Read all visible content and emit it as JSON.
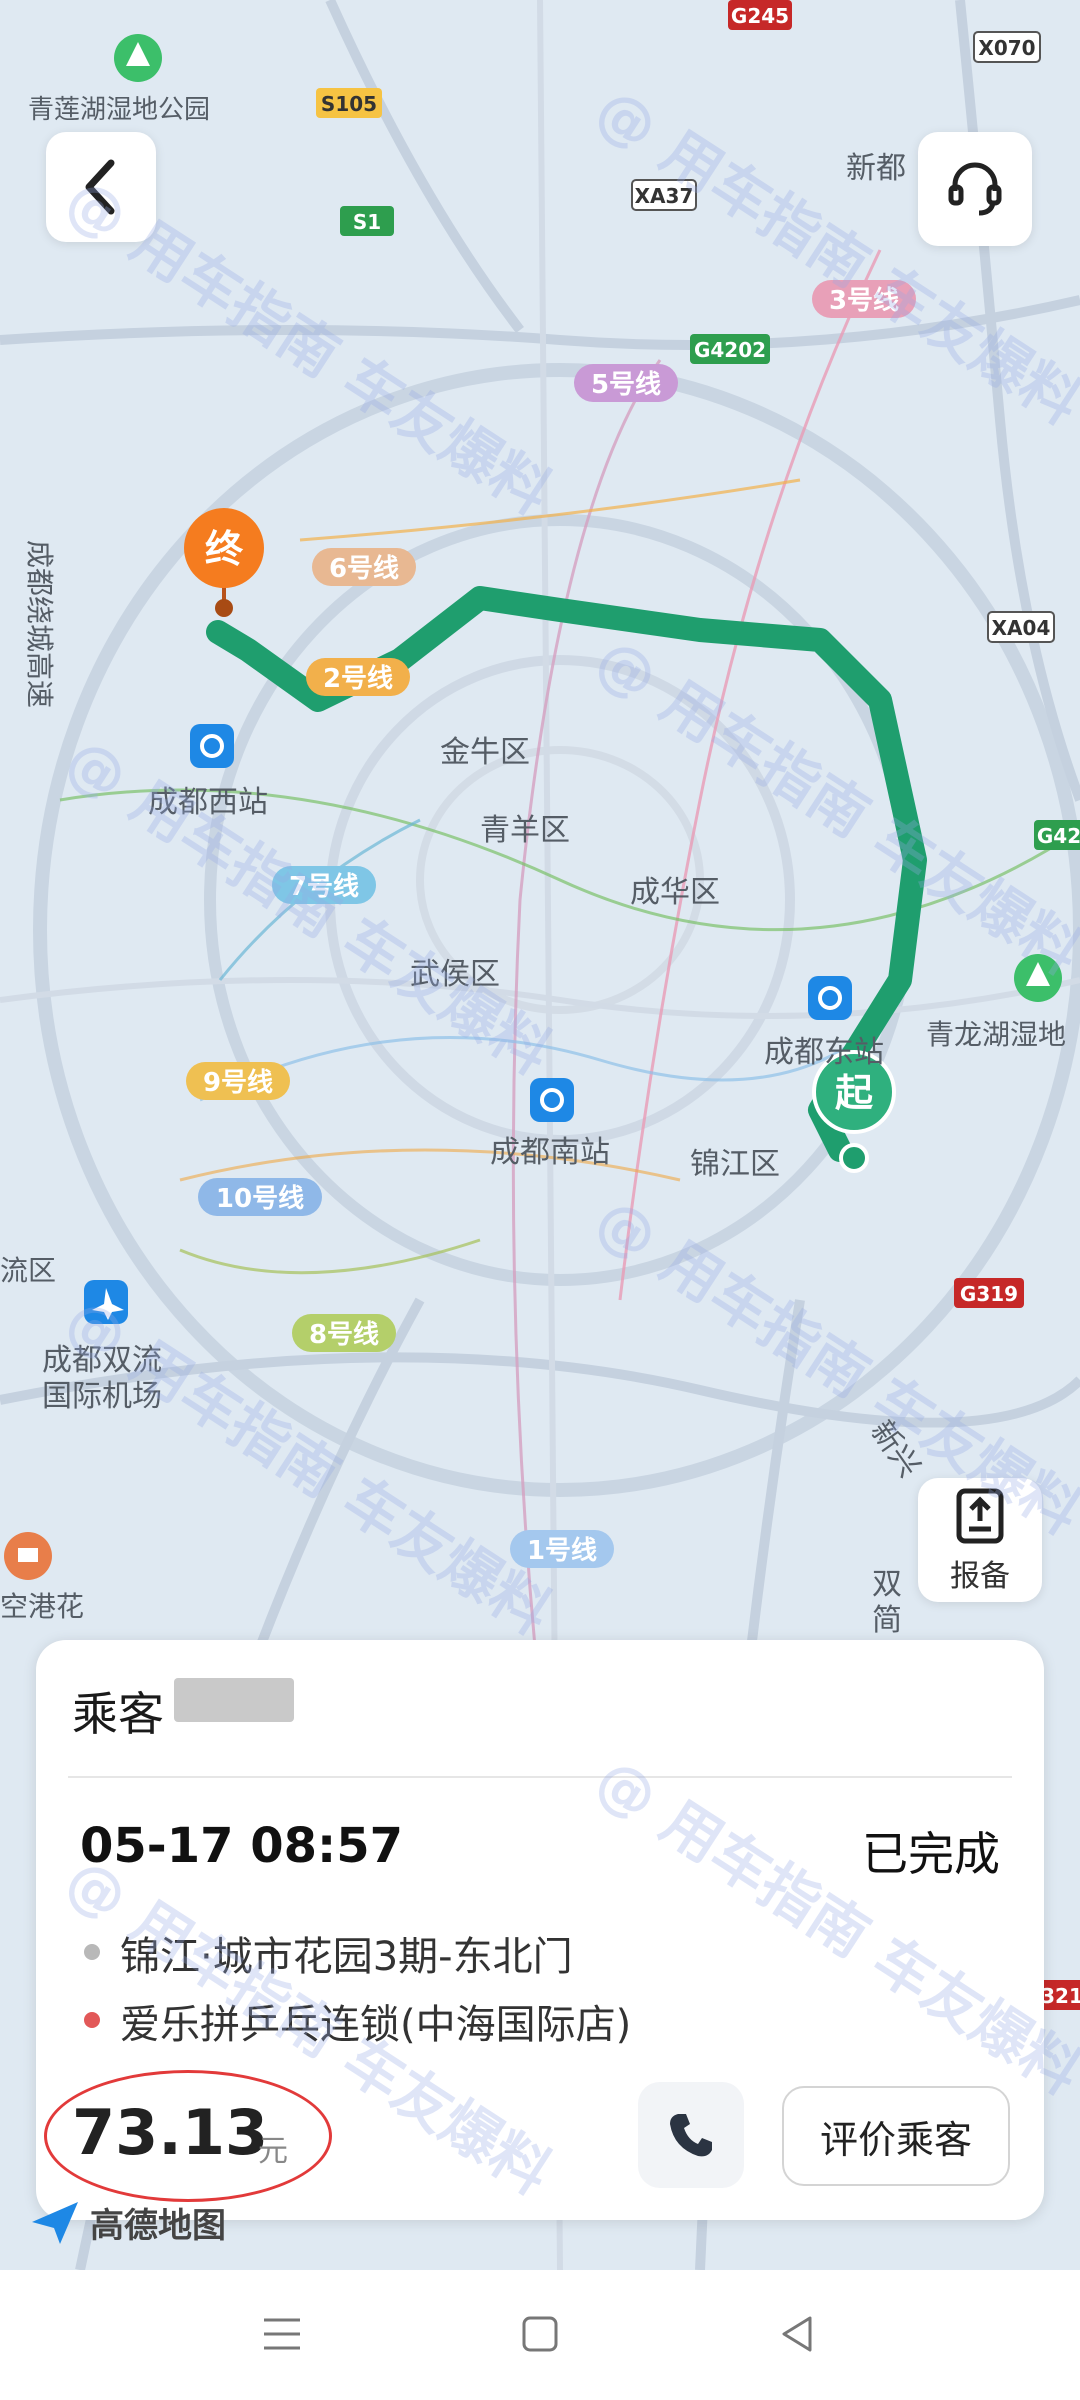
{
  "map": {
    "labels": {
      "lotus_wetland_nw": "青莲湖湿地公园",
      "xindu": "新都",
      "ring_expressway": "成都绕城高速",
      "jinniu": "金牛区",
      "qingyang": "青羊区",
      "chenghua": "成华区",
      "wuhou": "武侯区",
      "jinjiang": "锦江区",
      "chengdu_west_station": "成都西站",
      "chengdu_east_station": "成都东站",
      "chengdu_south_station": "成都南站",
      "airport_line1": "成都双流",
      "airport_line2": "国际机场",
      "lotus_wetland_e": "青龙湖湿地",
      "airport_area": "空港花",
      "region_left": "流区",
      "new_road": "新兴",
      "shuangliu": "双",
      "liu2": "简"
    },
    "road_badges": {
      "g245": "G245",
      "x070": "X070",
      "s105": "S105",
      "s1": "S1",
      "xa37": "XA37",
      "g4202": "G4202",
      "xa04": "XA04",
      "g42": "G42",
      "g319": "G319",
      "g321": "321"
    },
    "metro_lines": {
      "l3": "3号线",
      "l5": "5号线",
      "l6": "6号线",
      "l2": "2号线",
      "l7": "7号线",
      "l9": "9号线",
      "l10": "10号线",
      "l8": "8号线",
      "l1": "1号线"
    },
    "markers": {
      "start": "起",
      "end": "终"
    },
    "route_color": "#1f9e6e",
    "end_color": "#f57c1f"
  },
  "header": {
    "back_icon": "chevron-left-icon",
    "support_icon": "headset-icon"
  },
  "report": {
    "label": "报备",
    "icon": "report-icon"
  },
  "order": {
    "passenger_label": "乘客",
    "datetime": "05-17 08:57",
    "status": "已完成",
    "origin": "锦江·城市花园3期-东北门",
    "destination": "爱乐拼乒乓连锁(中海国际店)",
    "fare": "73.13",
    "unit": "元",
    "rate_button": "评价乘客",
    "phone_icon": "phone-icon"
  },
  "brand": {
    "logo_text": "高德地图"
  },
  "watermark": {
    "text": "@ 用车指南  车友爆料"
  },
  "navbar": {
    "menu_icon": "menu-icon",
    "home_icon": "home-square-icon",
    "back_icon": "back-triangle-icon"
  }
}
